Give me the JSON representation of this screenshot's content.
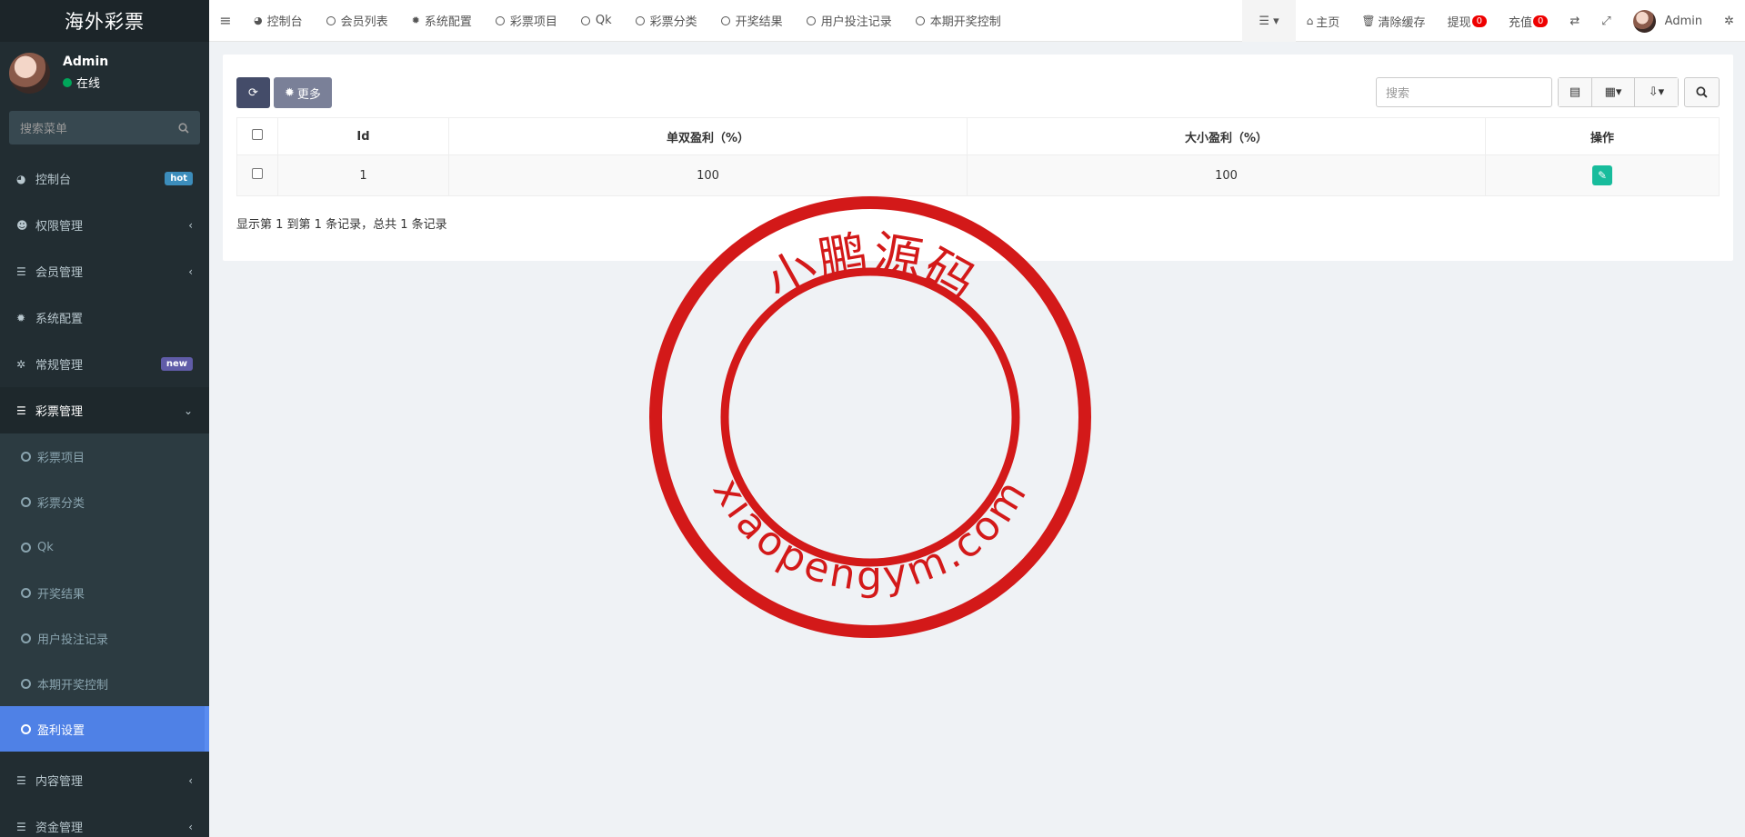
{
  "app": {
    "title": "海外彩票"
  },
  "user": {
    "name": "Admin",
    "status": "在线"
  },
  "sidebar": {
    "search_placeholder": "搜索菜单",
    "items": [
      {
        "label": "控制台",
        "icon": "dashboard-icon",
        "badge": "hot"
      },
      {
        "label": "权限管理",
        "icon": "users-icon"
      },
      {
        "label": "会员管理",
        "icon": "list-icon"
      },
      {
        "label": "系统配置",
        "icon": "gear-icon"
      },
      {
        "label": "常规管理",
        "icon": "cogs-icon",
        "badge": "new"
      },
      {
        "label": "彩票管理",
        "icon": "list-icon",
        "expanded": true
      },
      {
        "label": "内容管理",
        "icon": "list-icon"
      },
      {
        "label": "资金管理",
        "icon": "list-icon"
      }
    ],
    "sub_items": [
      "彩票项目",
      "彩票分类",
      "Qk",
      "开奖结果",
      "用户投注记录",
      "本期开奖控制",
      "盈利设置"
    ]
  },
  "topbar": {
    "tabs": [
      "控制台",
      "会员列表",
      "系统配置",
      "彩票项目",
      "Qk",
      "彩票分类",
      "开奖结果",
      "用户投注记录",
      "本期开奖控制"
    ],
    "home": "主页",
    "clear_cache": "清除缓存",
    "withdraw": "提现",
    "withdraw_count": "0",
    "recharge": "充值",
    "recharge_count": "0",
    "user": "Admin"
  },
  "toolbar": {
    "more_label": "更多",
    "search_placeholder": "搜索"
  },
  "table": {
    "headers": [
      "Id",
      "单双盈利（%）",
      "大小盈利（%）",
      "操作"
    ],
    "rows": [
      {
        "id": "1",
        "odd_even": "100",
        "big_small": "100"
      }
    ],
    "footer": "显示第 1 到第 1 条记录，总共 1 条记录"
  },
  "watermark": {
    "top_text": "小鹏源码",
    "bottom_text": "xiaopengym.com",
    "color": "#d31919"
  },
  "colors": {
    "sidebar_bg": "#222d32",
    "active_item": "#4f81e6",
    "edit_button": "#18bc9c",
    "badge_red": "#ee0000"
  }
}
